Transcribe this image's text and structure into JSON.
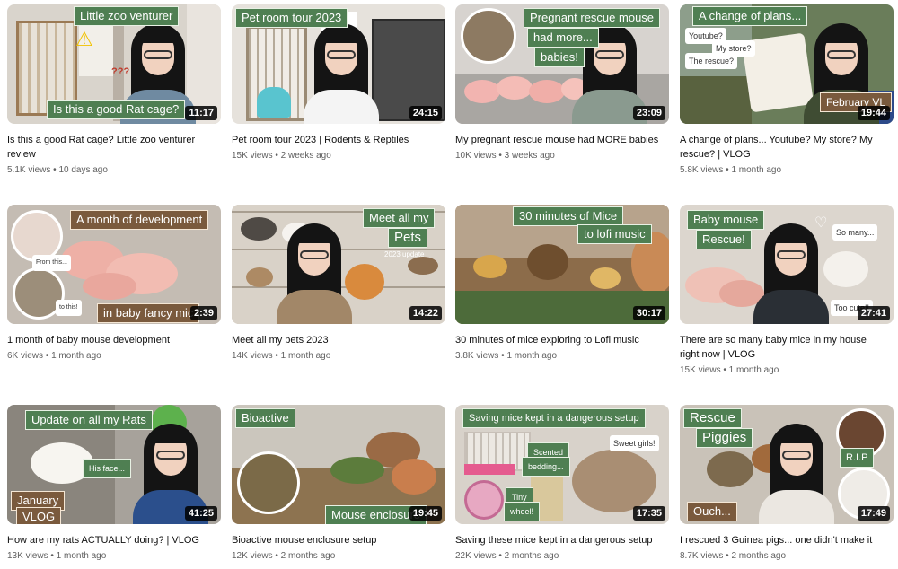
{
  "videos": [
    {
      "title": "Is this a good Rat cage? Little zoo venturer review",
      "views": "5.1K views",
      "age": "10 days ago",
      "duration": "11:17",
      "overlays": [
        "Little zoo venturer",
        "Is this a good Rat cage?",
        "???"
      ]
    },
    {
      "title": "Pet room tour 2023 | Rodents & Reptiles",
      "views": "15K views",
      "age": "2 weeks ago",
      "duration": "24:15",
      "overlays": [
        "Pet room tour 2023"
      ]
    },
    {
      "title": "My pregnant rescue mouse had MORE babies",
      "views": "10K views",
      "age": "3 weeks ago",
      "duration": "23:09",
      "overlays": [
        "Pregnant rescue mouse",
        "had more...",
        "babies!"
      ]
    },
    {
      "title": "A change of plans... Youtube? My store? My rescue? | VLOG",
      "views": "5.8K views",
      "age": "1 month ago",
      "duration": "19:44",
      "overlays": [
        "A change of plans...",
        "February VL",
        "Youtube?",
        "My store?",
        "The rescue?"
      ]
    },
    {
      "title": "1 month of baby mouse development",
      "views": "6K views",
      "age": "1 month ago",
      "duration": "2:39",
      "overlays": [
        "A month of development",
        "in baby fancy mic",
        "From this...",
        "to this!"
      ]
    },
    {
      "title": "Meet all my pets 2023",
      "views": "14K views",
      "age": "1 month ago",
      "duration": "14:22",
      "overlays": [
        "Meet all my",
        "Pets",
        "2023 update"
      ]
    },
    {
      "title": "30 minutes of mice exploring to Lofi music",
      "views": "3.8K views",
      "age": "1 month ago",
      "duration": "30:17",
      "overlays": [
        "30 minutes of Mice",
        "to lofi music"
      ]
    },
    {
      "title": "There are so many baby mice in my house right now | VLOG",
      "views": "15K views",
      "age": "1 month ago",
      "duration": "27:41",
      "overlays": [
        "Baby mouse",
        "Rescue!",
        "So many...",
        "Too cute!!"
      ]
    },
    {
      "title": "How are my rats ACTUALLY doing? | VLOG",
      "views": "13K views",
      "age": "1 month ago",
      "duration": "41:25",
      "overlays": [
        "Update on all my Rats",
        "January",
        "VLOG",
        "His face..."
      ]
    },
    {
      "title": "Bioactive mouse enclosure setup",
      "views": "12K views",
      "age": "2 months ago",
      "duration": "19:45",
      "overlays": [
        "Bioactive",
        "Mouse enclosure"
      ]
    },
    {
      "title": "Saving these mice kept in a dangerous setup",
      "views": "22K views",
      "age": "2 months ago",
      "duration": "17:35",
      "overlays": [
        "Saving mice kept in a dangerous setup",
        "Scented",
        "bedding...",
        "Sweet girls!",
        "Tiny",
        "wheel!"
      ]
    },
    {
      "title": "I rescued 3 Guinea pigs... one didn't make it",
      "views": "8.7K views",
      "age": "2 months ago",
      "duration": "17:49",
      "overlays": [
        "Rescue",
        "Piggies",
        "R.I.P",
        "Ouch..."
      ]
    }
  ],
  "meta_separator": "•",
  "icons": [
    "warning-icon",
    "heart-icon"
  ],
  "colors": {
    "tag_green": "#4f7f52",
    "tag_brown": "#7a5a3d",
    "duration_bg": "#000000",
    "meta_text": "#606060"
  }
}
